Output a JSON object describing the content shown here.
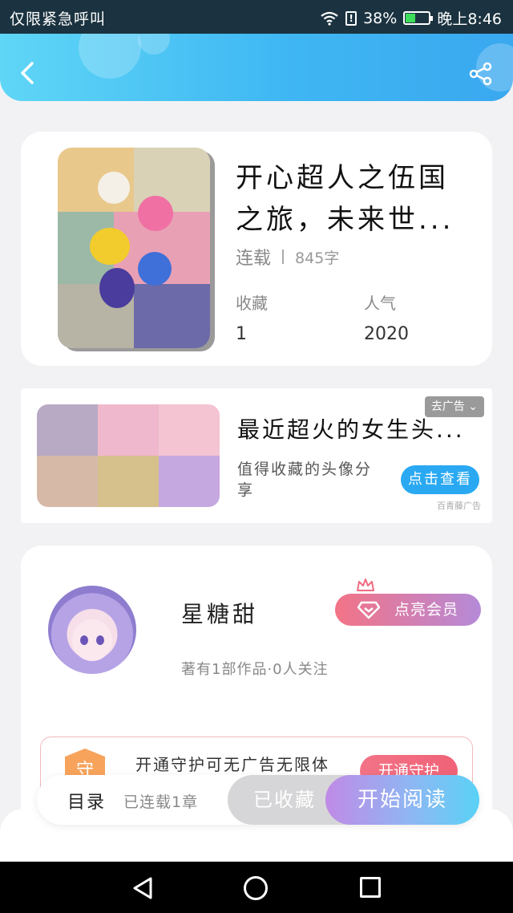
{
  "statusbar": {
    "left_text": "仅限紧急呼叫",
    "battery": "38%",
    "time": "晚上8:46"
  },
  "book": {
    "title_line1": "开心超人之伍国",
    "title_line2": "之旅，未来世...",
    "status": "连载",
    "word_count": "845字",
    "favorites_label": "收藏",
    "favorites_value": "1",
    "popularity_label": "人气",
    "popularity_value": "2020"
  },
  "ad": {
    "title": "最近超火的女生头...",
    "description": "值得收藏的头像分享",
    "close_label": "去广告",
    "cta_label": "点击查看",
    "source": "百青藤广告"
  },
  "author": {
    "name": "星糖甜",
    "info": "著有1部作品·0人关注",
    "vip_label": "点亮会员",
    "guard_text": "开通守护可无广告无限体",
    "guard_icon_text": "守",
    "guard_button": "开通守护"
  },
  "bottom_bar": {
    "toc_label": "目录",
    "toc_status": "已连载1章",
    "collected_label": "已收藏",
    "read_label": "开始阅读"
  },
  "colors": {
    "header": "#3fb7f3",
    "accent_blue": "#2aa9f2",
    "vip_pink": "#f37386",
    "read_purple": "#c08ae6"
  }
}
